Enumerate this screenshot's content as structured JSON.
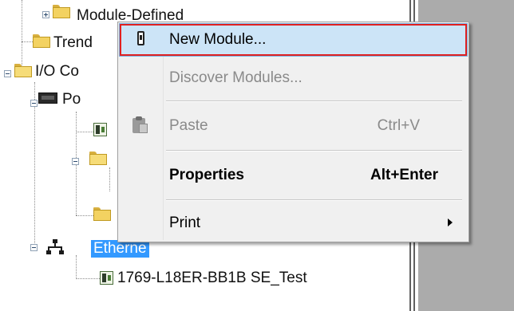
{
  "tree": {
    "items": [
      {
        "label": "Module-Defined"
      },
      {
        "label": "Trend"
      },
      {
        "label": "I/O Co"
      },
      {
        "label": "Po"
      },
      {
        "label": "Etherne"
      },
      {
        "label": "1769-L18ER-BB1B SE_Test"
      }
    ]
  },
  "context_menu": {
    "items": [
      {
        "label": "New Module...",
        "shortcut": "",
        "state": "highlighted"
      },
      {
        "label": "Discover Modules...",
        "shortcut": "",
        "state": "disabled"
      },
      {
        "label": "Paste",
        "shortcut": "Ctrl+V",
        "state": "disabled"
      },
      {
        "label": "Properties",
        "shortcut": "Alt+Enter",
        "state": "bold"
      },
      {
        "label": "Print",
        "shortcut": "",
        "state": "submenu"
      }
    ]
  },
  "colors": {
    "selection": "#3399ff",
    "highlight_frame": "#e02020",
    "menu_hover": "#cce4f7",
    "right_panel": "#ababab"
  }
}
